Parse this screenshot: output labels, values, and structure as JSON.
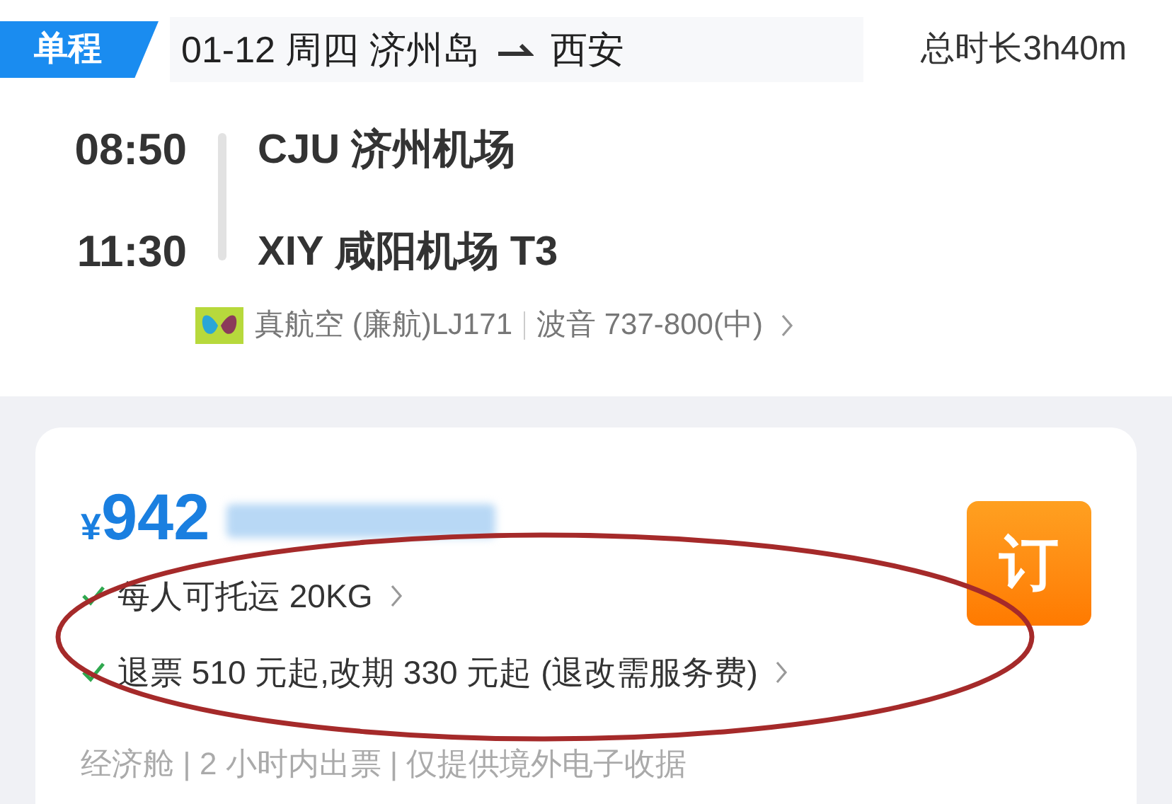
{
  "header": {
    "trip_type": "单程",
    "date": "01-12",
    "weekday": "周四",
    "from_city": "济州岛",
    "to_city": "西安",
    "duration": "总时长3h40m"
  },
  "flight": {
    "depart_time": "08:50",
    "depart_airport": "CJU 济州机场",
    "arrive_time": "11:30",
    "arrive_airport": "XIY 咸阳机场 T3",
    "airline": "真航空 (廉航)LJ171",
    "aircraft": "波音 737-800(中)"
  },
  "offer": {
    "currency": "¥",
    "price": "942",
    "book": "订",
    "benefits": [
      {
        "text": "每人可托运 20KG"
      },
      {
        "text": "退票 510 元起,改期 330 元起 (退改需服务费)"
      }
    ],
    "footnote": "经济舱 | 2 小时内出票 | 仅提供境外电子收据"
  }
}
